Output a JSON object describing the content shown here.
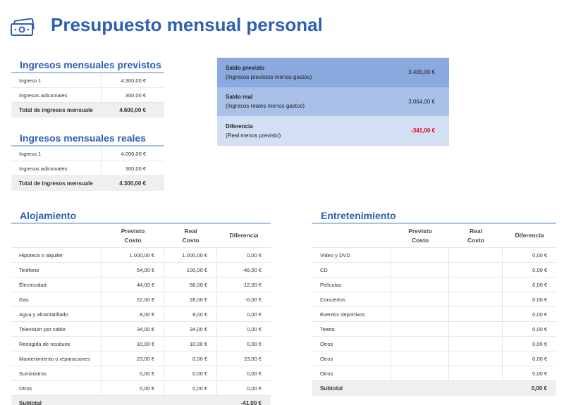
{
  "page_title": "Presupuesto mensual personal",
  "colors": {
    "accent": "#2e5fb3",
    "negative": "#e3001b",
    "summary_dark": "#8aa9de",
    "summary_mid": "#a9c1e9",
    "summary_light": "#d3dff3"
  },
  "icons": {
    "title": "money-bill-icon"
  },
  "ingresos_previstos": {
    "title": "Ingresos mensuales previstos",
    "rows": [
      {
        "label": "Ingreso 1",
        "value": "4.300,00 €"
      },
      {
        "label": "Ingresos adicionales",
        "value": "300,00 €"
      }
    ],
    "total": {
      "label": "Total de ingresos mensuale",
      "value": "4.600,00 €"
    }
  },
  "ingresos_reales": {
    "title": "Ingresos mensuales reales",
    "rows": [
      {
        "label": "Ingreso 1",
        "value": "4.000,00 €"
      },
      {
        "label": "Ingresos adicionales",
        "value": "300,00 €"
      }
    ],
    "total": {
      "label": "Total de ingresos mensuale",
      "value": "4.300,00 €"
    }
  },
  "summary": [
    {
      "title": "Saldo previsto",
      "subtitle": "(Ingresos previstos menos gastos)",
      "value": "3.405,00 €"
    },
    {
      "title": "Saldo real",
      "subtitle": "(Ingresos reales menos gastos)",
      "value": "3.064,00 €"
    },
    {
      "title": "Diferencia",
      "subtitle": "(Real menos previsto)",
      "value": "-341,00 €"
    }
  ],
  "columns": {
    "previsto_1": "Previsto",
    "previsto_2": "Costo",
    "real_1": "Real",
    "real_2": "Costo",
    "diferencia": "Diferencia"
  },
  "alojamiento": {
    "title": "Alojamiento",
    "rows": [
      {
        "label": "Hipoteca o alquiler",
        "previsto": "1.000,00 €",
        "real": "1.000,00 €",
        "diferencia": "0,00 €"
      },
      {
        "label": "Teléfono",
        "previsto": "54,00 €",
        "real": "100,00 €",
        "diferencia": "-46,00 €"
      },
      {
        "label": "Electricidad",
        "previsto": "44,00 €",
        "real": "56,00 €",
        "diferencia": "-12,00 €"
      },
      {
        "label": "Gas",
        "previsto": "22,00 €",
        "real": "28,00 €",
        "diferencia": "-6,00 €"
      },
      {
        "label": "Agua y alcantarillado",
        "previsto": "8,00 €",
        "real": "8,00 €",
        "diferencia": "0,00 €"
      },
      {
        "label": "Televisión por cable",
        "previsto": "34,00 €",
        "real": "34,00 €",
        "diferencia": "0,00 €"
      },
      {
        "label": "Recogida de residuos",
        "previsto": "10,00 €",
        "real": "10,00 €",
        "diferencia": "0,00 €"
      },
      {
        "label": "Mantenimiento o reparaciones",
        "previsto": "23,00 €",
        "real": "0,00 €",
        "diferencia": "23,00 €"
      },
      {
        "label": "Suministros",
        "previsto": "0,00 €",
        "real": "0,00 €",
        "diferencia": "0,00 €"
      },
      {
        "label": "Otros",
        "previsto": "0,00 €",
        "real": "0,00 €",
        "diferencia": "0,00 €"
      }
    ],
    "subtotal": {
      "label": "Subtotal",
      "diferencia": "-41,00 €"
    }
  },
  "entretenimiento": {
    "title": "Entretenimiento",
    "rows": [
      {
        "label": "Video y DVD",
        "previsto": "",
        "real": "",
        "diferencia": "0,00 €"
      },
      {
        "label": "CD",
        "previsto": "",
        "real": "",
        "diferencia": "0,00 €"
      },
      {
        "label": "Películas",
        "previsto": "",
        "real": "",
        "diferencia": "0,00 €"
      },
      {
        "label": "Conciertos",
        "previsto": "",
        "real": "",
        "diferencia": "0,00 €"
      },
      {
        "label": "Eventos deportivos",
        "previsto": "",
        "real": "",
        "diferencia": "0,00 €"
      },
      {
        "label": "Teatro",
        "previsto": "",
        "real": "",
        "diferencia": "0,00 €"
      },
      {
        "label": "Otros",
        "previsto": "",
        "real": "",
        "diferencia": "0,00 €"
      },
      {
        "label": "Otros",
        "previsto": "",
        "real": "",
        "diferencia": "0,00 €"
      },
      {
        "label": "Otros",
        "previsto": "",
        "real": "",
        "diferencia": "0,00 €"
      }
    ],
    "subtotal": {
      "label": "Subtotal",
      "diferencia": "0,00 €"
    }
  }
}
